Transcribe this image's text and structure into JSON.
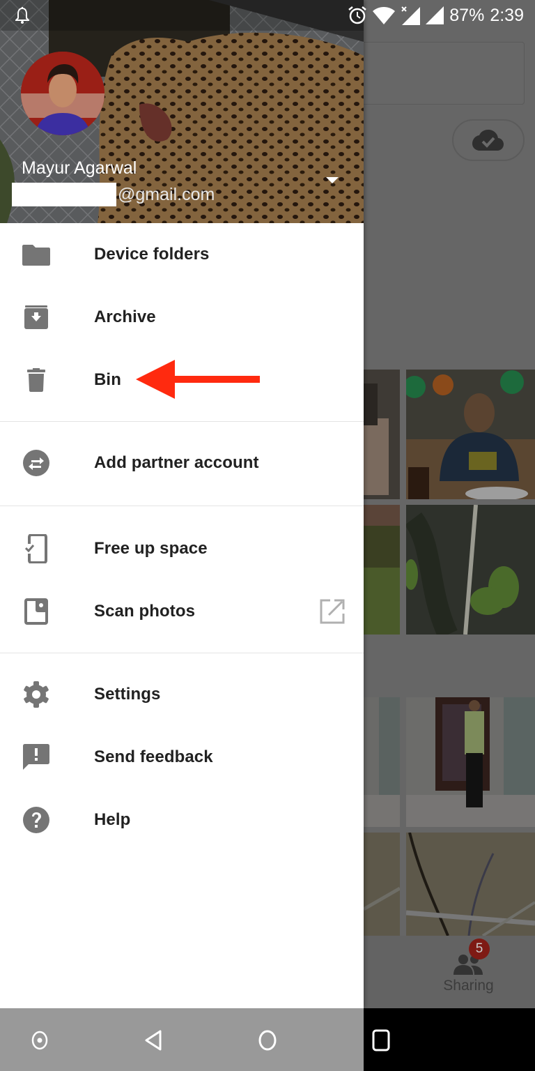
{
  "status_bar": {
    "notification_icon": "bell-icon",
    "alarm_icon": "alarm-clock-icon",
    "wifi_icon": "wifi-icon",
    "signal_icons": [
      "no-signal-icon",
      "signal-icon"
    ],
    "battery": "87%",
    "time": "2:39"
  },
  "drawer": {
    "account": {
      "name": "Mayur Agarwal",
      "email_suffix": "@gmail.com",
      "email_redacted": true
    },
    "sections": [
      {
        "items": [
          {
            "id": "device-folders",
            "label": "Device folders",
            "icon": "folder-icon"
          },
          {
            "id": "archive",
            "label": "Archive",
            "icon": "archive-icon"
          },
          {
            "id": "bin",
            "label": "Bin",
            "icon": "trash-icon"
          }
        ]
      },
      {
        "items": [
          {
            "id": "add-partner-account",
            "label": "Add partner account",
            "icon": "swap-arrows-icon"
          }
        ]
      },
      {
        "items": [
          {
            "id": "free-up-space",
            "label": "Free up space",
            "icon": "phone-check-icon"
          },
          {
            "id": "scan-photos",
            "label": "Scan photos",
            "icon": "photo-scan-icon",
            "trailing_icon": "open-external-icon"
          }
        ]
      },
      {
        "items": [
          {
            "id": "settings",
            "label": "Settings",
            "icon": "gear-icon"
          },
          {
            "id": "send-feedback",
            "label": "Send feedback",
            "icon": "feedback-icon"
          },
          {
            "id": "help",
            "label": "Help",
            "icon": "help-icon"
          }
        ]
      }
    ]
  },
  "annotation": {
    "type": "arrow",
    "color": "#ff2a0f",
    "points_to": "Bin"
  },
  "background_app": {
    "bottom_nav": {
      "sharing_label": "Sharing",
      "sharing_badge": "5"
    }
  },
  "nav_bar": {
    "buttons": [
      "assistant-icon",
      "back-icon",
      "home-icon",
      "recents-icon"
    ]
  }
}
